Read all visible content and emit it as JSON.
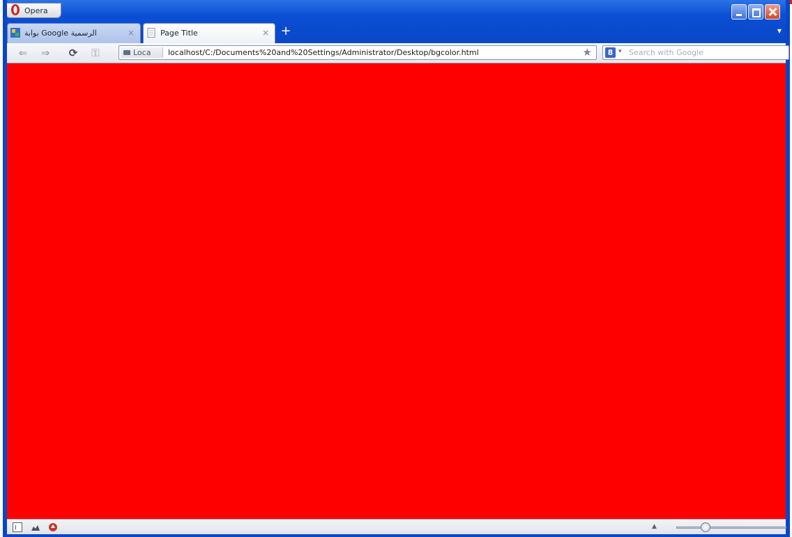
{
  "browser": {
    "menu_label": "Opera"
  },
  "tabs": [
    {
      "label": "بوابة Google الرسمية",
      "state": "inactive"
    },
    {
      "label": "Page Title",
      "state": "active"
    }
  ],
  "tab_close_glyph": "×",
  "new_tab_glyph": "+",
  "toolbar": {
    "back_glyph": "⇐",
    "forward_glyph": "⇒",
    "reload_glyph": "⟳",
    "key_glyph": "⚿",
    "site_badge_label": "Loca",
    "url": "localhost/C:/Documents%20and%20Settings/Administrator/Desktop/bgcolor.html",
    "bookmark_glyph": "★",
    "search_engine_letter": "8",
    "search_dropdown_glyph": "▾",
    "search_placeholder": "Search with Google"
  },
  "page": {
    "background_color": "#ff0000"
  },
  "statusbar": {
    "zoom_up_glyph": "▲",
    "zoom_level_fraction": 0.25
  },
  "icons": [
    "opera-logo-icon",
    "page-favicon-icon",
    "google-favicon-icon",
    "back-icon",
    "forward-icon",
    "reload-icon",
    "key-icon",
    "star-icon",
    "panel-toggle-icon",
    "unite-icon",
    "turbo-icon"
  ]
}
